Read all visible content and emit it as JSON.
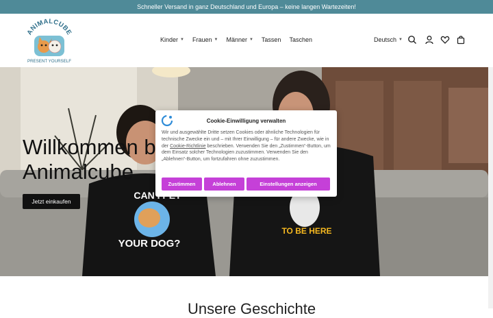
{
  "announcement": "Schneller Versand in ganz Deutschland und Europa – keine langen Wartezeiten!",
  "logo": {
    "top_text": "ANIMALCUBE",
    "bottom_text": "PRESENT YOURSELF"
  },
  "nav": [
    {
      "label": "Kinder",
      "has_dropdown": true
    },
    {
      "label": "Frauen",
      "has_dropdown": true
    },
    {
      "label": "Männer",
      "has_dropdown": true
    },
    {
      "label": "Tassen",
      "has_dropdown": false
    },
    {
      "label": "Taschen",
      "has_dropdown": false
    }
  ],
  "language": "Deutsch",
  "icons": [
    "search-icon",
    "account-icon",
    "wishlist-heart-icon",
    "cart-bag-icon"
  ],
  "hero": {
    "title_line1": "Willkommen bei",
    "title_line2": "Animalcube",
    "cta": "Jetzt einkaufen",
    "shirt_left": {
      "line1": "CAN I PET",
      "line2": "YOUR DOG?"
    },
    "shirt_right": {
      "line1": "TO BE HERE"
    }
  },
  "below_heading": "Unsere Geschichte",
  "cookie": {
    "title": "Cookie-Einwilligung verwalten",
    "body_before_link": "Wir und ausgewählte Dritte setzen Cookies oder ähnliche Technologien für technische Zwecke ein und – mit Ihrer Einwilligung – für andere Zwecke, wie in der ",
    "link": "Cookie-Richtlinie",
    "body_after_link": " beschrieben. Verwenden Sie den „Zustimmen“-Button, um dem Einsatz solcher Technologien zuzustimmen. Verwenden Sie den „Ablehnen“-Button, um fortzufahren ohne zuzustimmen.",
    "accept": "Zustimmen",
    "reject": "Ablehnen",
    "settings": "Einstellungen anzeigen"
  },
  "colors": {
    "announcement_bg": "#4f8a98",
    "cookie_button": "#c540d8",
    "hero_button": "#111111"
  }
}
